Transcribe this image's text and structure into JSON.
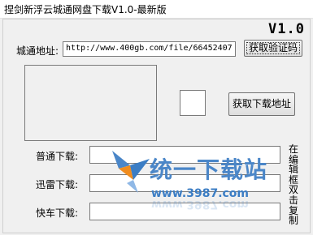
{
  "window": {
    "title": "捏剑新浮云城通网盘下载V1.0-最新版",
    "version": "V1.0"
  },
  "form": {
    "url_label": "城通地址:",
    "url_value": "http://www.400gb.com/file/66452407",
    "captcha_button": "获取验证码",
    "get_link_button": "获取下载地址",
    "normal_download_label": "普通下载:",
    "xunlei_download_label": "迅雷下载:",
    "kuaiche_download_label": "快车下载:",
    "side_note": "在编辑框双击复制"
  },
  "watermark": {
    "brand": "统一下载站",
    "site": "www.3987.com",
    "colors": {
      "blue": "#3b7dc4",
      "orange": "#f08c1e"
    }
  }
}
